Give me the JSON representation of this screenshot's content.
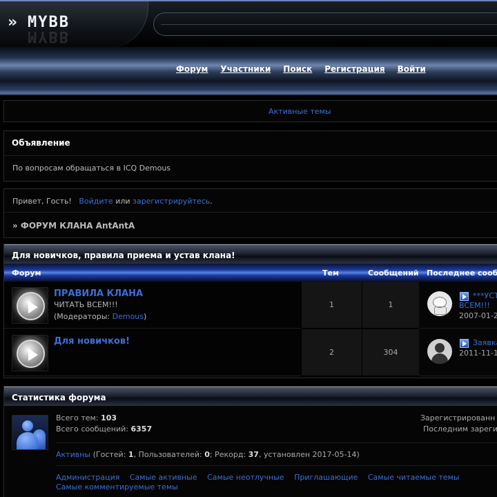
{
  "header": {
    "logo_chevron": "»",
    "logo_text": "MYBB"
  },
  "nav": {
    "items": [
      "Форум",
      "Участники",
      "Поиск",
      "Регистрация",
      "Войти"
    ]
  },
  "active_topics": {
    "label": "Активные темы"
  },
  "announcement": {
    "title": "Объявление",
    "text": "По вопросам обращаться в ICQ Demous"
  },
  "welcome": {
    "greeting": "Привет, Гость!",
    "login_link": "Войдите",
    "or": "или",
    "register_link": "зарегистрируйтесь",
    "period": "."
  },
  "breadcrumb": {
    "text": "» ФОРУМ КЛАНА AntAntA"
  },
  "category": {
    "title": "Для новичков, правила приема и устав клана!",
    "columns": {
      "forum": "Форум",
      "topics": "Тем",
      "posts": "Сообщений",
      "last_post": "Последнее сооб"
    },
    "forums": [
      {
        "name": "ПРАВИЛА КЛАНА",
        "description": "ЧИТАТЬ ВСЕМ!!!",
        "moderators_prefix": "(Модераторы: ",
        "moderator": "Demous",
        "moderators_suffix": ")",
        "topics": "1",
        "posts": "1",
        "last_post_line1": "***УСТ",
        "last_post_line2": "ВСЕМ!!!",
        "last_post_date": "2007-01-2"
      },
      {
        "name": "Для новичков!",
        "topics": "2",
        "posts": "304",
        "last_post_line1": "Заявка",
        "last_post_date": "2011-11-1"
      }
    ]
  },
  "stats": {
    "title": "Статистика форума",
    "topics_label": "Всего тем: ",
    "topics_value": "103",
    "posts_label": "Всего сообщений: ",
    "posts_value": "6357",
    "registered_label": "Зарегистрированн",
    "last_registered_label": "Последним зареги",
    "online_link": "Активны",
    "online_guests_label": " (Гостей: ",
    "online_guests": "1",
    "online_users_label": ", Пользователей: ",
    "online_users": "0",
    "online_record_label": "; Рекорд: ",
    "online_record": "37",
    "online_record_date": ", установлен 2017-05-14)",
    "links": [
      "Администрация",
      "Самые активные",
      "Самые неотлучные",
      "Приглашающие",
      "Самые читаемые темы",
      "Самые комментируемые темы"
    ]
  },
  "colors": {
    "link": "#3a6fd8",
    "background": "#000000",
    "nav_accent": "#6e84ab",
    "column_header": "#1b3aa0"
  }
}
